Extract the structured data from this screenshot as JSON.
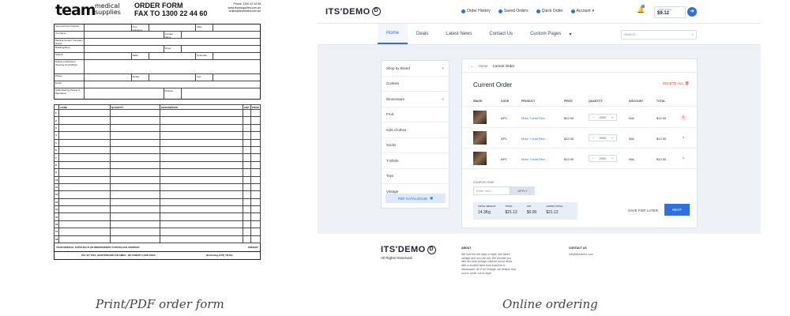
{
  "captions": {
    "left": "Print/PDF order form",
    "right": "Online ordering"
  },
  "order_form": {
    "logo_main": "team",
    "logo_sub_1": "medical",
    "logo_sub_2": "supplies",
    "title_1": "ORDER FORM",
    "title_2": "FAX TO 1300 22 44 60",
    "contact_1": "Phone: 1300 22 44 50",
    "contact_2": "www.teamsupplies.com.au",
    "contact_3": "orders@teammed.com.au",
    "fields": {
      "account_number": "Team Account Number",
      "your_reference": "Your reference",
      "date": "Date",
      "contact_name": "Contact Name",
      "co_name": "C/o Name",
      "medical_company": "Medical Centre/ Company Name",
      "building": "Building/Shop",
      "street": "Street",
      "suburb": "Suburb",
      "state": "State",
      "postcode": "Postcode",
      "delivery": "Delivery Instruction Opening Hours/Days",
      "phone": "Phone",
      "mobile": "Mobile",
      "fax": "Fax",
      "email": "Email",
      "authorised": "Authorised by (Name & Signature)",
      "position": "Position"
    },
    "columns": [
      "CODE",
      "QUANTITY",
      "DESCRIPTION",
      "UNIT",
      "PRICE"
    ],
    "row_numbers": [
      "1",
      "2",
      "3",
      "4",
      "5",
      "6",
      "7",
      "8",
      "9",
      "10",
      "11",
      "12",
      "13",
      "14",
      "15",
      "16",
      "17",
      "18"
    ],
    "footer_1": "TEAM MEDICAL SUPPLIES IS AN INDEPENDENT AUSTRALIAN COMPANY",
    "footer_1_right": "FREIGHT",
    "footer_2a": "PAY BY VISA, MASTERCARD OR AMEX - NO CREDIT CARD FEES",
    "footer_2b": "(Excluding GST) TOTAL"
  },
  "web": {
    "brand": "ITS'DEMO",
    "brand_mark": "D",
    "top_nav": [
      "Order History",
      "Saved Orders",
      "Quick Order",
      "Account"
    ],
    "cart_count": "2",
    "your_total_label": "YOUR TOTAL",
    "your_total_value": "$9.12",
    "menu": [
      "Home",
      "Deals",
      "Latest News",
      "Contact Us",
      "Custom Pages"
    ],
    "search_placeholder": "Search...",
    "sidebar": [
      "Shop by Brand",
      "Cookies",
      "Dinnerware",
      "Fruit",
      "Kids Clothes",
      "Socks",
      "T-Shirts",
      "Toys",
      "Vintage"
    ],
    "pdf_catalogue": "PDF CATALOGUE",
    "breadcrumb_home": "Home",
    "breadcrumb_current": "Current Order",
    "page_title": "Current Order",
    "delete_all": "DELETE ALL",
    "table_headers": [
      "IMAGE",
      "CODE",
      "PRODUCT",
      "PRICE",
      "QUANTITY",
      "DISCOUNT",
      "TOTAL"
    ],
    "rows": [
      {
        "code": "AP1",
        "product": "Moto T-shirt Red...",
        "price": "$12.00",
        "qty": "2000",
        "discount": "N/A",
        "total": "$12.00"
      },
      {
        "code": "AP1",
        "product": "Moto T-shirt Red...",
        "price": "$12.00",
        "qty": "2000",
        "discount": "N/A",
        "total": "$12.00"
      },
      {
        "code": "AP1",
        "product": "Moto T-shirt Red...",
        "price": "$12.00",
        "qty": "2000",
        "discount": "N/A",
        "total": "$12.00"
      }
    ],
    "coupon_label": "COUPON CODE",
    "coupon_placeholder": "Enter here...",
    "apply": "APPLY",
    "summary": [
      {
        "label": "TOTAL WEIGHT",
        "value": "14.3Kg"
      },
      {
        "label": "TOTAL",
        "value": "$21.12"
      },
      {
        "label": "VAT",
        "value": "$0.00"
      },
      {
        "label": "GROSS TOTAL",
        "value": "$21.12"
      }
    ],
    "save_later": "SAVE FOR LATER",
    "next": "NEXT",
    "footer": {
      "rights": "All Rights Reserved.",
      "about_title": "ABOUT",
      "about_text": "We love the old days of style. We adore vintage and you can tell. We provide you with the best vintage-inspired decor items with a modern twist from knickers to dinnerware. At V for Vintage, we believe that cool is never out of style.",
      "contact_title": "CONTACT US",
      "contact_email": "info@its'tdemo.com"
    }
  }
}
